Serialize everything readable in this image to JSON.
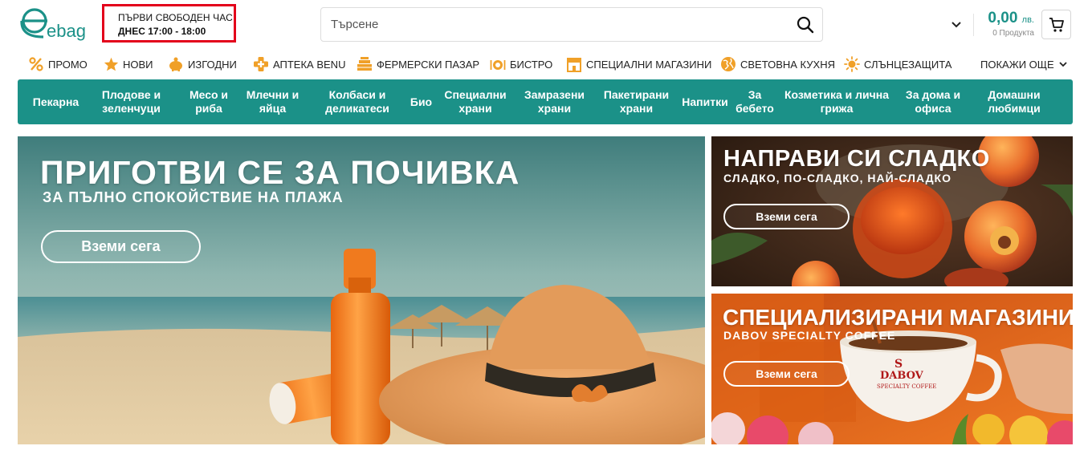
{
  "header": {
    "logo_text": "ebag",
    "slot_title": "ПЪРВИ СВОБОДЕН ЧАС",
    "slot_time": "ДНЕС 17:00 - 18:00",
    "search_placeholder": "Търсене",
    "cart_total": "0,00",
    "cart_currency": "лв.",
    "cart_count": "0 Продукта"
  },
  "quicklinks": [
    {
      "label": "ПРОМО",
      "icon": "percent-icon"
    },
    {
      "label": "НОВИ",
      "icon": "star-icon"
    },
    {
      "label": "ИЗГОДНИ",
      "icon": "piggy-bank-icon"
    },
    {
      "label": "АПТЕКА BENU",
      "icon": "pharmacy-cross-icon"
    },
    {
      "label": "ФЕРМЕРСКИ ПАЗАР",
      "icon": "farm-crate-icon"
    },
    {
      "label": "БИСТРО",
      "icon": "cutlery-plate-icon"
    },
    {
      "label": "СПЕЦИАЛНИ МАГАЗИНИ",
      "icon": "storefront-icon"
    },
    {
      "label": "СВЕТОВНА КУХНЯ",
      "icon": "globe-icon"
    },
    {
      "label": "СЛЪНЦЕЗАЩИТА",
      "icon": "sun-icon"
    }
  ],
  "quicklinks_more": "ПОКАЖИ ОЩЕ",
  "categories": [
    {
      "line1": "Пекарна",
      "line2": ""
    },
    {
      "line1": "Плодове и",
      "line2": "зеленчуци"
    },
    {
      "line1": "Месо и",
      "line2": "риба"
    },
    {
      "line1": "Млечни и",
      "line2": "яйца"
    },
    {
      "line1": "Колбаси и",
      "line2": "деликатеси"
    },
    {
      "line1": "Био",
      "line2": ""
    },
    {
      "line1": "Специални",
      "line2": "храни"
    },
    {
      "line1": "Замразени",
      "line2": "храни"
    },
    {
      "line1": "Пакетирани",
      "line2": "храни"
    },
    {
      "line1": "Напитки",
      "line2": ""
    },
    {
      "line1": "За",
      "line2": "бебето"
    },
    {
      "line1": "Козметика и лична",
      "line2": "грижа"
    },
    {
      "line1": "За дома и",
      "line2": "офиса"
    },
    {
      "line1": "Домашни",
      "line2": "любимци"
    }
  ],
  "banners": {
    "main": {
      "title": "ПРИГОТВИ СЕ ЗА ПОЧИВКА",
      "subtitle": "ЗА ПЪЛНО СПОКОЙСТВИЕ НА ПЛАЖА",
      "button": "Вземи сега"
    },
    "sweet": {
      "title": "НАПРАВИ СИ СЛАДКО",
      "subtitle": "СЛАДКО, ПО-СЛАДКО, НАЙ-СЛАДКО",
      "button": "Вземи сега"
    },
    "shop": {
      "title": "СПЕЦИАЛИЗИРАНИ МАГАЗИНИ",
      "subtitle": "DABOV SPECIALTY COFFEE",
      "button": "Вземи сега",
      "cup_brand": "DABOV",
      "cup_sub": "SPECIALTY COFFEE"
    }
  },
  "colors": {
    "brand_teal": "#1b9188",
    "highlight_red": "#e3001b",
    "icon_orange": "#f0a028"
  }
}
